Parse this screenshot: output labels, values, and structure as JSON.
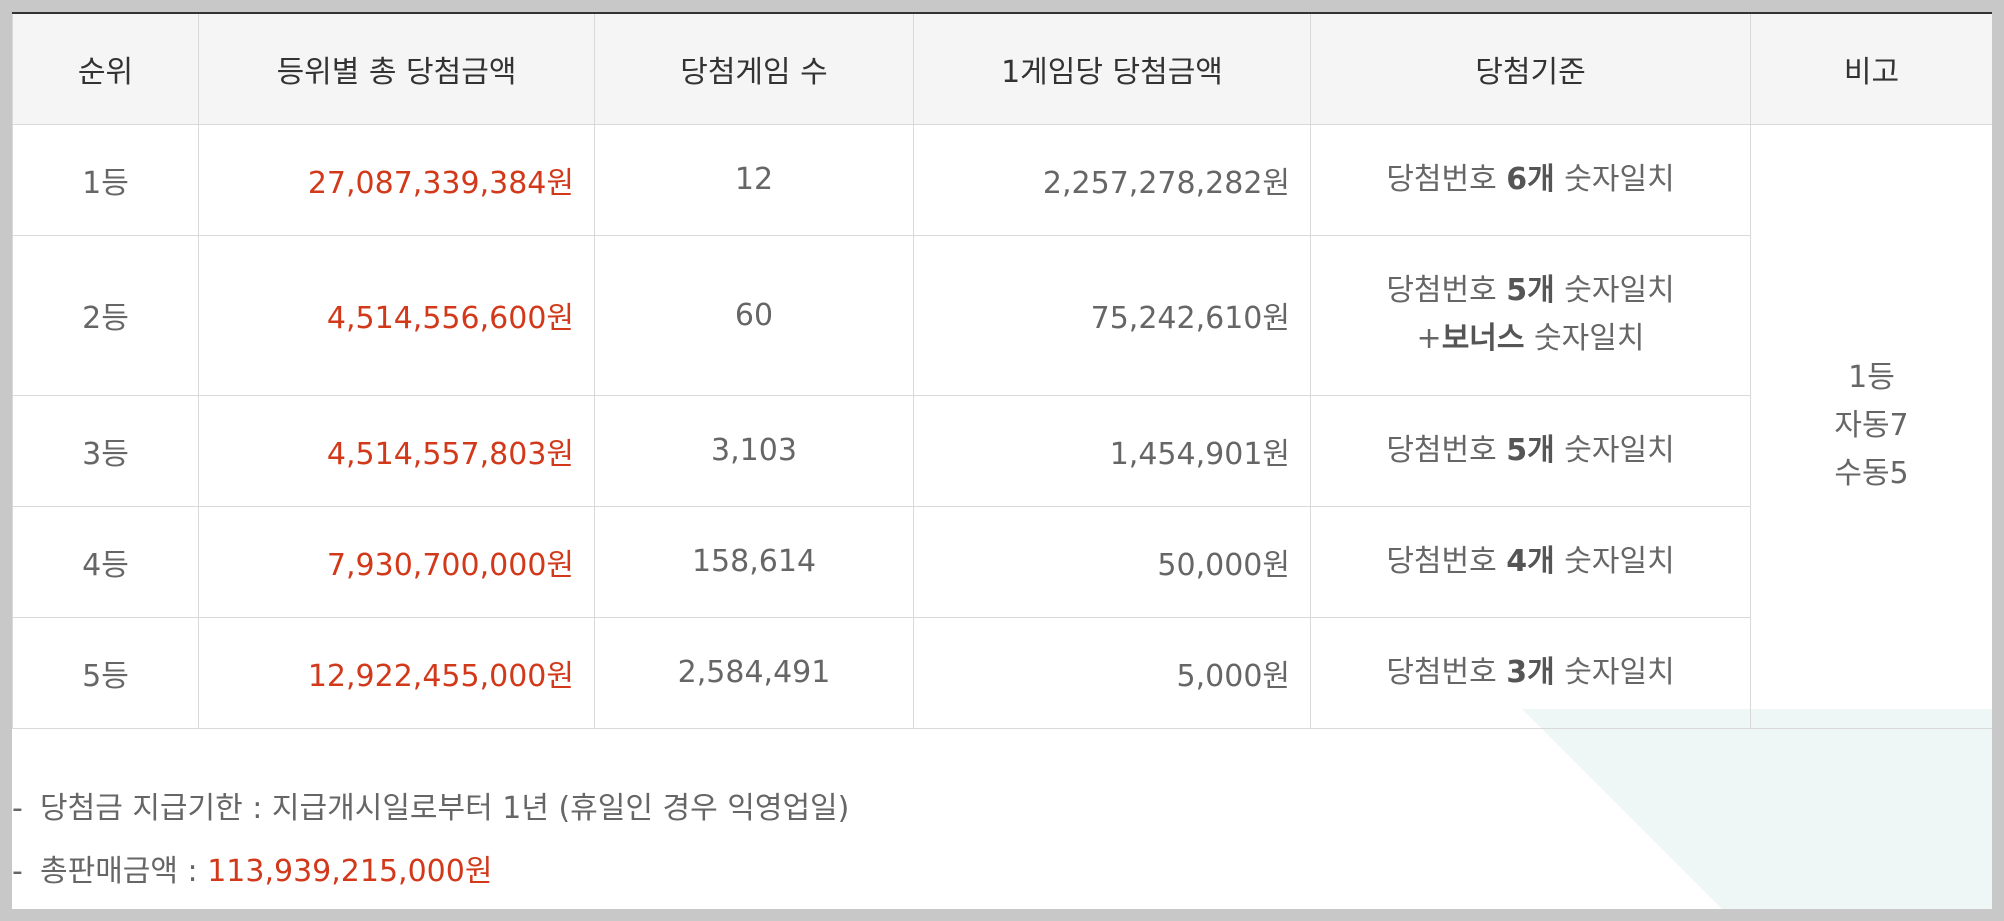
{
  "table": {
    "headers": [
      "순위",
      "등위별 총 당첨금액",
      "당첨게임 수",
      "1게임당 당첨금액",
      "당첨기준",
      "비고"
    ],
    "rows": [
      {
        "rank": "1등",
        "total": "27,087,339,384원",
        "winners": "12",
        "per_game": "2,257,278,282원",
        "criteria_prefix": "당첨번호 ",
        "criteria_bold": "6개",
        "criteria_suffix": " 숫자일치"
      },
      {
        "rank": "2등",
        "total": "4,514,556,600원",
        "winners": "60",
        "per_game": "75,242,610원",
        "criteria_prefix": "당첨번호 ",
        "criteria_bold": "5개",
        "criteria_suffix": " 숫자일치",
        "criteria_line2_prefix": "+",
        "criteria_line2_bold": "보너스",
        "criteria_line2_suffix": " 숫자일치"
      },
      {
        "rank": "3등",
        "total": "4,514,557,803원",
        "winners": "3,103",
        "per_game": "1,454,901원",
        "criteria_prefix": "당첨번호 ",
        "criteria_bold": "5개",
        "criteria_suffix": " 숫자일치"
      },
      {
        "rank": "4등",
        "total": "7,930,700,000원",
        "winners": "158,614",
        "per_game": "50,000원",
        "criteria_prefix": "당첨번호 ",
        "criteria_bold": "4개",
        "criteria_suffix": " 숫자일치"
      },
      {
        "rank": "5등",
        "total": "12,922,455,000원",
        "winners": "2,584,491",
        "per_game": "5,000원",
        "criteria_prefix": "당첨번호 ",
        "criteria_bold": "3개",
        "criteria_suffix": " 숫자일치"
      }
    ],
    "note": {
      "line1": "1등",
      "line2": "자동7",
      "line3": "수동5"
    }
  },
  "footer": {
    "dash": "-",
    "payment_label": "당첨금 지급기한 : 지급개시일로부터 1년 (휴일인 경우 익영업일)",
    "sales_label": "총판매금액 : ",
    "sales_value": "113,939,215,000원"
  },
  "colors": {
    "accent_red": "#d2391b",
    "header_bg": "#f5f5f5",
    "border": "#d9d9d9"
  }
}
